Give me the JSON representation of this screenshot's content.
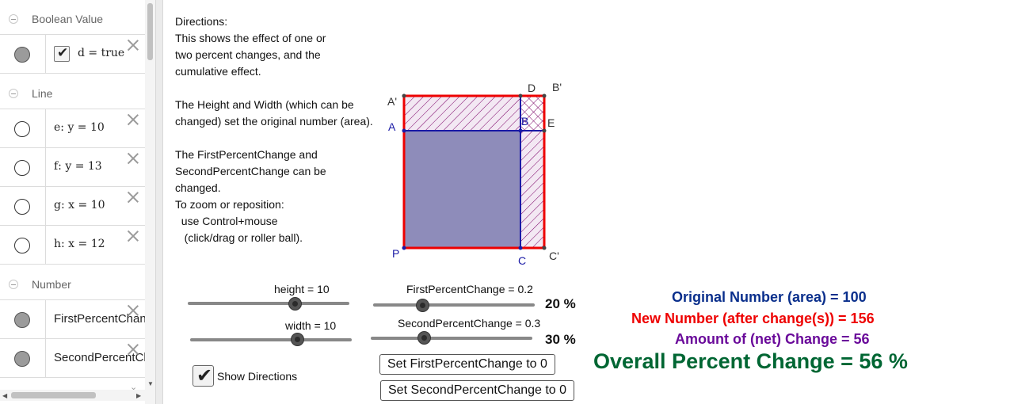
{
  "algebra": {
    "groups": {
      "boolean": "Boolean Value",
      "line": "Line",
      "number": "Number"
    },
    "rows": {
      "d": "d = true",
      "e": "e: y = 10",
      "f": "f: y = 13",
      "g": "g: x = 10",
      "h": "h: x = 12",
      "n1": "FirstPercentChange",
      "n2": "SecondPercentChange"
    }
  },
  "directions": "Directions:\nThis shows the effect of one or\ntwo percent changes, and the\ncumulative effect.\n\nThe Height and Width (which can be\nchanged) set the original number (area).\n\nThe FirstPercentChange and\nSecondPercentChange can be\nchanged.\nTo zoom or reposition:\n  use Control+mouse\n   (click/drag or roller ball).",
  "points": {
    "A1": "A'",
    "A": "A",
    "P": "P",
    "D": "D",
    "B1": "B'",
    "B": "B",
    "E": "E",
    "C": "C",
    "C1": "C'"
  },
  "sliders": {
    "height": {
      "label": "height = 10",
      "value": 10
    },
    "width": {
      "label": "width = 10",
      "value": 10
    },
    "first": {
      "label": "FirstPercentChange = 0.2",
      "value": 0.2,
      "pct": "20 %"
    },
    "second": {
      "label": "SecondPercentChange = 0.3",
      "value": 0.3,
      "pct": "30 %"
    }
  },
  "show_directions": {
    "label": "Show Directions",
    "checked": true
  },
  "buttons": {
    "set_first": "Set FirstPercentChange to 0",
    "set_second": "Set SecondPercentChange to 0"
  },
  "results": {
    "original": "Original Number (area) = 100",
    "new": "New Number (after change(s)) = 156",
    "amount": "Amount of (net) Change = 56",
    "overall": "Overall Percent Change = 56 %"
  },
  "colors": {
    "blue": "#0a2f8c",
    "red": "#ee0000",
    "purple": "#6a0a9a",
    "green": "#006633",
    "area_fill": "#8e8cba",
    "point_blue": "#1a1aa6"
  }
}
